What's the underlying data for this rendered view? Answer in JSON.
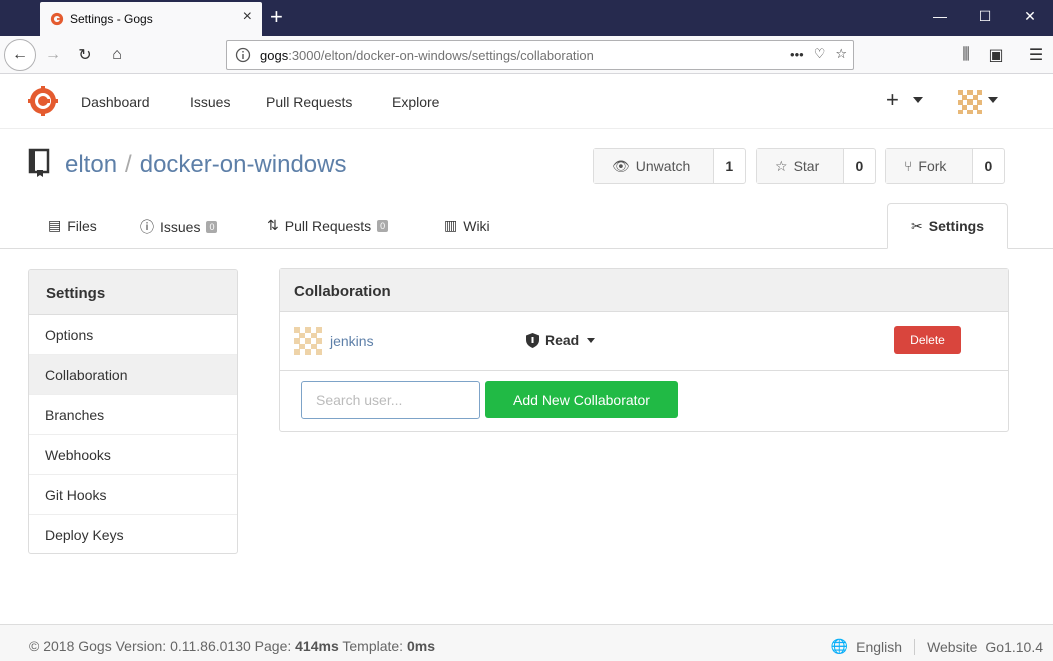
{
  "browser": {
    "tab_title": "Settings - Gogs",
    "url_host": "gogs",
    "url_path": ":3000/elton/docker-on-windows/settings/collaboration",
    "url_actions_icon": "ellipsis-icon"
  },
  "header": {
    "nav": [
      "Dashboard",
      "Issues",
      "Pull Requests",
      "Explore"
    ],
    "plus_label": "+"
  },
  "repo": {
    "owner": "elton",
    "separator": "/",
    "name": "docker-on-windows",
    "unwatch_label": "Unwatch",
    "unwatch_count": "1",
    "star_label": "Star",
    "star_count": "0",
    "fork_label": "Fork",
    "fork_count": "0"
  },
  "tabs": {
    "files": "Files",
    "issues": "Issues",
    "issues_count": "0",
    "pulls": "Pull Requests",
    "pulls_count": "0",
    "wiki": "Wiki",
    "settings": "Settings"
  },
  "sidebar": {
    "title": "Settings",
    "items": [
      {
        "label": "Options"
      },
      {
        "label": "Collaboration"
      },
      {
        "label": "Branches"
      },
      {
        "label": "Webhooks"
      },
      {
        "label": "Git Hooks"
      },
      {
        "label": "Deploy Keys"
      }
    ]
  },
  "collaboration": {
    "title": "Collaboration",
    "collaborator_name": "jenkins",
    "permission": "Read",
    "delete_label": "Delete",
    "search_placeholder": "Search user...",
    "add_label": "Add New Collaborator"
  },
  "footer": {
    "copyright": "© 2018 Gogs Version: 0.11.86.0130 Page: ",
    "page_time": "414ms",
    "template_label": " Template: ",
    "template_time": "0ms",
    "language": "English",
    "website_label": "Website",
    "website_version": "Go1.10.4"
  },
  "colors": {
    "titlebar": "#262a4e",
    "link": "#5d7fa8",
    "delete": "#d9453d",
    "add": "#21ba45"
  }
}
